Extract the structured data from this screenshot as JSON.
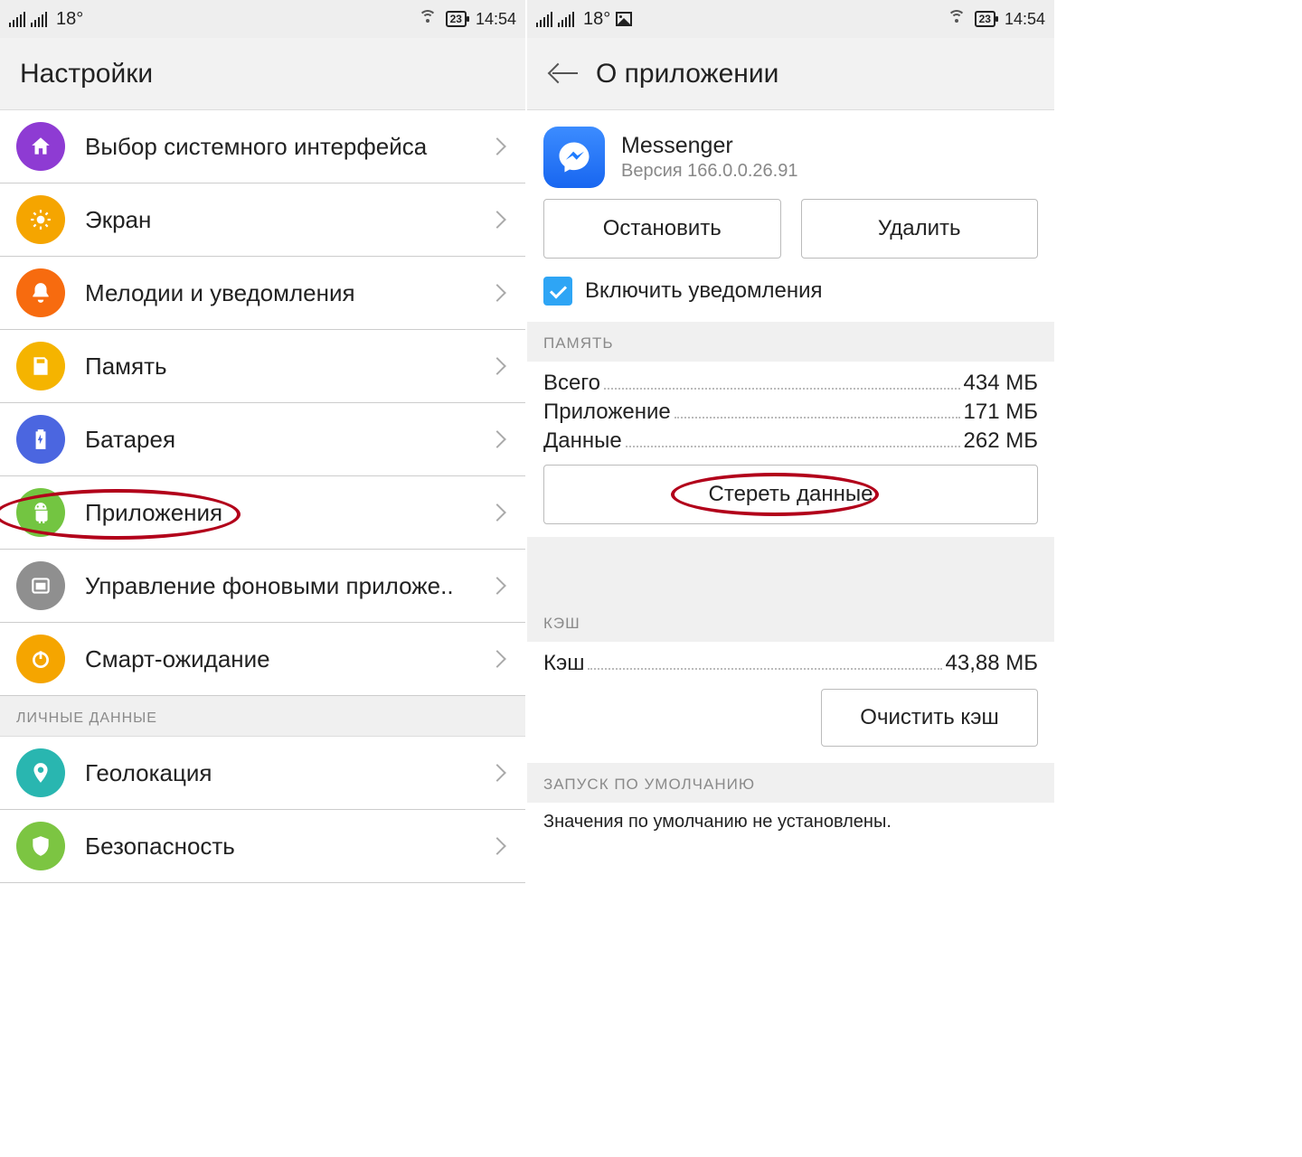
{
  "status": {
    "temp": "18°",
    "battery": "23",
    "time": "14:54"
  },
  "left": {
    "title": "Настройки",
    "section_personal": "ЛИЧНЫЕ ДАННЫЕ",
    "items": {
      "ui": "Выбор системного интерфейса",
      "display": "Экран",
      "sound": "Мелодии и уведомления",
      "storage": "Память",
      "battery": "Батарея",
      "apps": "Приложения",
      "bg": "Управление фоновыми приложе..",
      "smart": "Смарт-ожидание",
      "geo": "Геолокация",
      "security": "Безопасность"
    }
  },
  "right": {
    "title": "О приложении",
    "app_name": "Messenger",
    "app_version": "Версия 166.0.0.26.91",
    "btn_stop": "Остановить",
    "btn_delete": "Удалить",
    "chk_notify": "Включить уведомления",
    "hdr_memory": "ПАМЯТЬ",
    "mem_total_k": "Всего",
    "mem_total_v": "434 МБ",
    "mem_app_k": "Приложение",
    "mem_app_v": "171 МБ",
    "mem_data_k": "Данные",
    "mem_data_v": "262 МБ",
    "btn_erase": "Стереть данные",
    "hdr_cache": "КЭШ",
    "cache_k": "Кэш",
    "cache_v": "43,88 МБ",
    "btn_clear_cache": "Очистить кэш",
    "hdr_launch": "ЗАПУСК ПО УМОЛЧАНИЮ",
    "defaults_note": "Значения по умолчанию не установлены."
  }
}
